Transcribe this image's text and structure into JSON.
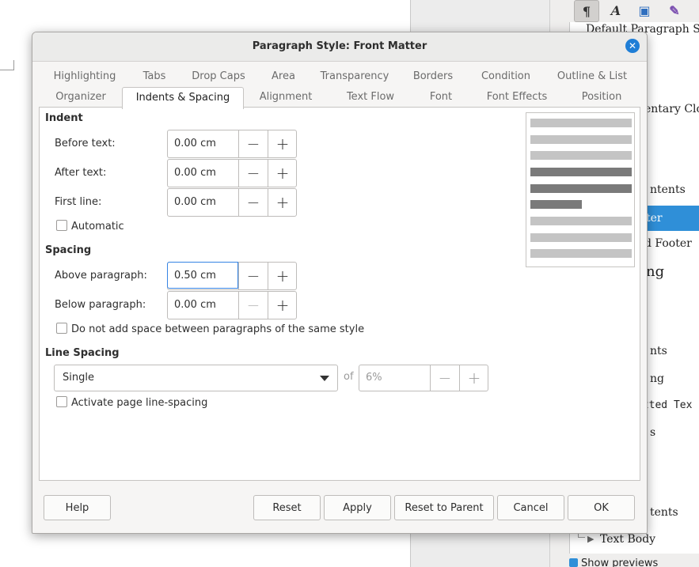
{
  "background": {
    "sidebar_tools": [
      "paragraph-styles-icon",
      "character-styles-icon",
      "frame-styles-icon",
      "page-styles-icon"
    ],
    "sidebar_items": [
      {
        "label": "Default Paragraph Style",
        "style": "normal"
      },
      {
        "label": "entary Close",
        "style": "normal"
      },
      {
        "label": "ntents",
        "style": "normal"
      },
      {
        "label": "ter",
        "style": "selected"
      },
      {
        "label": "d Footer",
        "style": "normal"
      },
      {
        "label": "ng",
        "style": "big"
      },
      {
        "label": "nts",
        "style": "normal"
      },
      {
        "label": "ng",
        "style": "normal"
      },
      {
        "label": "atted Tex",
        "style": "mono"
      },
      {
        "label": "s",
        "style": "normal"
      },
      {
        "label": "tents",
        "style": "normal"
      },
      {
        "label": "Text Body",
        "style": "tree"
      }
    ],
    "show_previews": "Show previews",
    "accent_color": "#2f8fd8"
  },
  "dialog": {
    "title": "Paragraph Style: Front Matter",
    "tabs_row1": [
      "Highlighting",
      "Tabs",
      "Drop Caps",
      "Area",
      "Transparency",
      "Borders",
      "Condition",
      "Outline & List"
    ],
    "tabs_row2": [
      "Organizer",
      "Indents & Spacing",
      "Alignment",
      "Text Flow",
      "Font",
      "Font Effects",
      "Position"
    ],
    "active_tab": "Indents & Spacing",
    "indent": {
      "title": "Indent",
      "before_text": {
        "label": "Before text:",
        "value": "0.00 cm"
      },
      "after_text": {
        "label": "After text:",
        "value": "0.00 cm"
      },
      "first_line": {
        "label": "First line:",
        "value": "0.00 cm"
      },
      "automatic": {
        "label": "Automatic",
        "checked": false
      }
    },
    "spacing": {
      "title": "Spacing",
      "above": {
        "label": "Above paragraph:",
        "value": "0.50 cm"
      },
      "below": {
        "label": "Below paragraph:",
        "value": "0.00 cm"
      },
      "no_space_same_style": {
        "label": "Do not add space between paragraphs of the same style",
        "checked": false
      }
    },
    "line_spacing": {
      "title": "Line Spacing",
      "selected": "Single",
      "of_label": "of",
      "of_value": "6%",
      "page_line_spacing": {
        "label": "Activate page line-spacing",
        "checked": false
      }
    },
    "buttons": {
      "help": "Help",
      "reset": "Reset",
      "apply": "Apply",
      "reset_to_parent": "Reset to Parent",
      "cancel": "Cancel",
      "ok": "OK"
    },
    "focus_color": "#3584e4",
    "close_color": "#1f7ed6"
  }
}
